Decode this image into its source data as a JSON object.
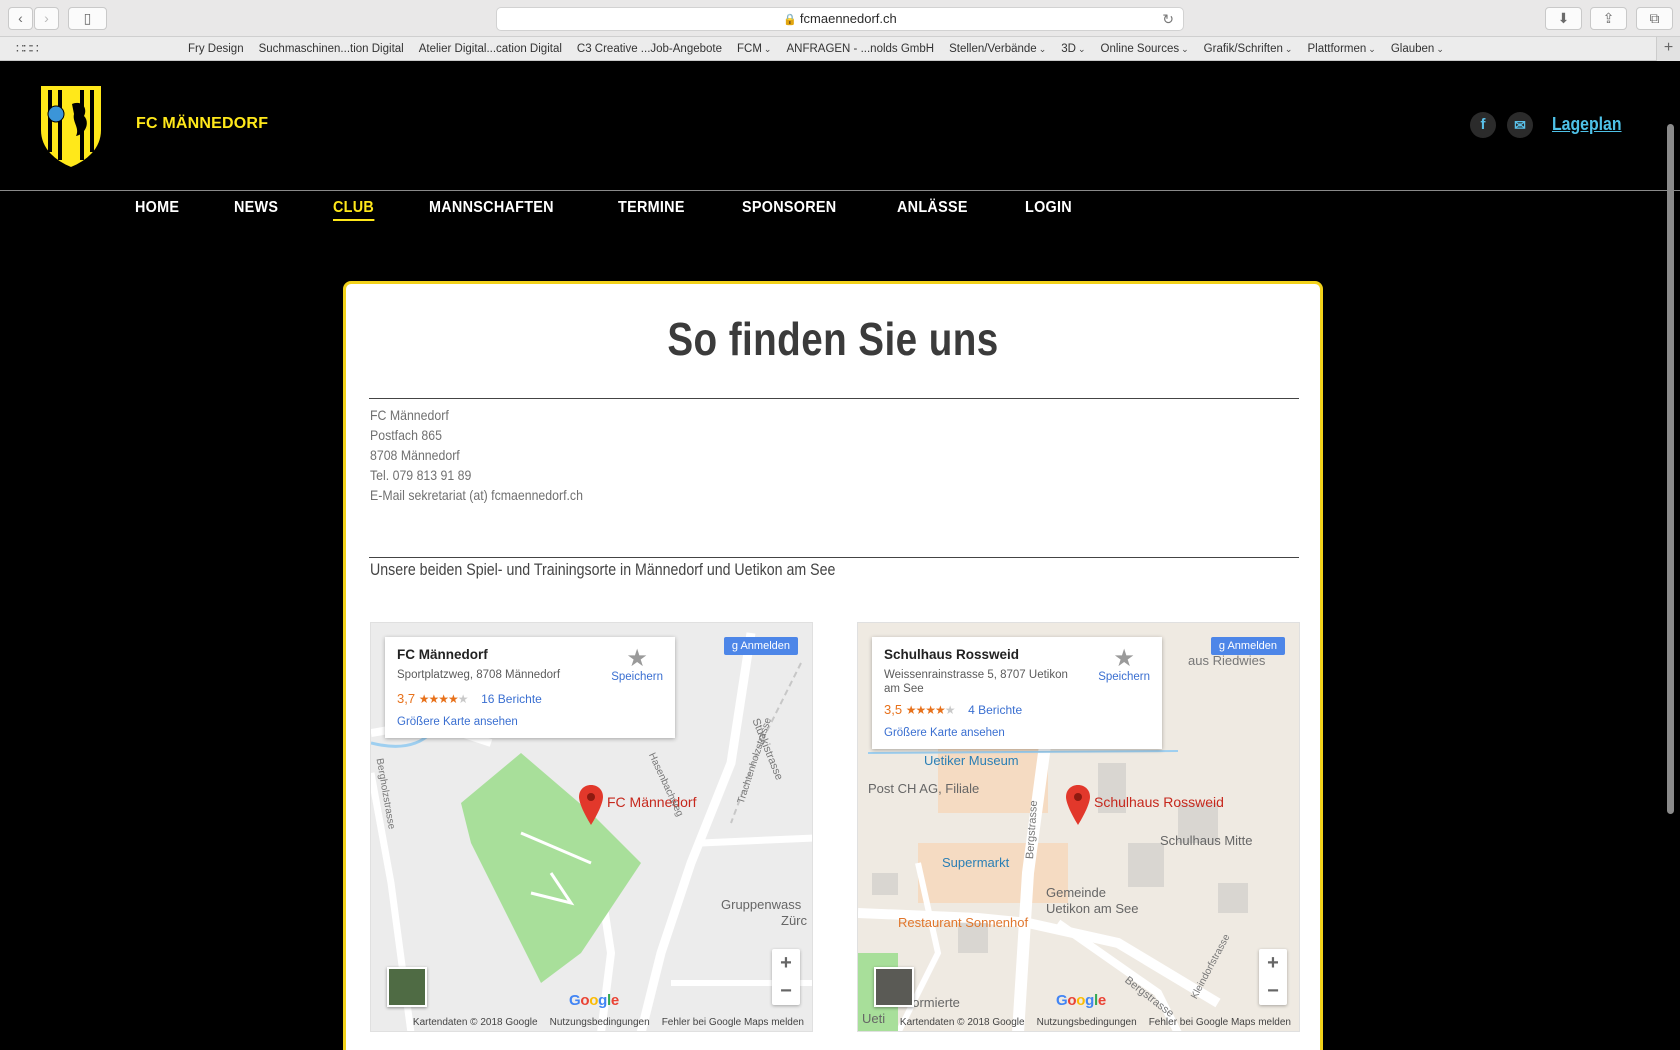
{
  "browser": {
    "url": "fcmaennedorf.ch",
    "bookmarks": [
      {
        "label": "Fry Design",
        "menu": false
      },
      {
        "label": "Suchmaschinen...tion Digital",
        "menu": false
      },
      {
        "label": "Atelier Digital...cation Digital",
        "menu": false
      },
      {
        "label": "C3 Creative ...Job-Angebote",
        "menu": false
      },
      {
        "label": "FCM",
        "menu": true
      },
      {
        "label": "ANFRAGEN - ...nolds GmbH",
        "menu": false
      },
      {
        "label": "Stellen/Verbände",
        "menu": true
      },
      {
        "label": "3D",
        "menu": true
      },
      {
        "label": "Online Sources",
        "menu": true
      },
      {
        "label": "Grafik/Schriften",
        "menu": true
      },
      {
        "label": "Plattformen",
        "menu": true
      },
      {
        "label": "Glauben",
        "menu": true
      }
    ]
  },
  "site": {
    "brand": "FC MÄNNEDORF",
    "logo_text": "FC MÄNNEDORF",
    "lageplan": "Lageplan",
    "nav": [
      {
        "label": "HOME",
        "active": false
      },
      {
        "label": "NEWS",
        "active": false
      },
      {
        "label": "CLUB",
        "active": true
      },
      {
        "label": "MANNSCHAFTEN",
        "active": false
      },
      {
        "label": "TERMINE",
        "active": false
      },
      {
        "label": "SPONSOREN",
        "active": false
      },
      {
        "label": "ANLÄSSE",
        "active": false
      },
      {
        "label": "LOGIN",
        "active": false
      }
    ]
  },
  "content": {
    "heading": "So finden Sie uns",
    "address": [
      "FC Männedorf",
      "Postfach 865",
      "8708 Männedorf",
      "Tel. 079 813 91 89",
      "E-Mail sekretariat (at) fcmaennedorf.ch"
    ],
    "subtitle": "Unsere beiden Spiel- und Trainingsorte in Männedorf und Uetikon am See"
  },
  "maps": [
    {
      "title": "FC Männedorf",
      "address": "Sportplatzweg, 8708 Männedorf",
      "rating": "3,7",
      "stars_full": 3.7,
      "reviews": "16 Berichte",
      "save": "Speichern",
      "larger": "Größere Karte ansehen",
      "signin": "Anmelden",
      "pin_label": "FC Männedorf",
      "labels": [
        "Stuckistrasse",
        "Trachtenholzstrasse",
        "Gruppenwass",
        "Zürc",
        "Bergholzstrasse",
        "Hasenbachweg"
      ],
      "attribution": [
        "Kartendaten © 2018 Google",
        "Nutzungsbedingungen",
        "Fehler bei Google Maps melden"
      ],
      "google": "Google"
    },
    {
      "title": "Schulhaus Rossweid",
      "address": "Weissenrainstrasse 5, 8707 Uetikon am See",
      "rating": "3,5",
      "stars_full": 3.5,
      "reviews": "4 Berichte",
      "save": "Speichern",
      "larger": "Größere Karte ansehen",
      "signin": "Anmelden",
      "pin_label": "Schulhaus Rossweid",
      "labels": [
        "Uetiker Museum",
        "Post CH AG, Filiale",
        "Schulhaus Mitte",
        "Supermarkt",
        "Gemeinde",
        "Uetikon am See",
        "Restaurant Sonnenhof",
        "Bergstrasse",
        "Bergstrasse",
        "aus Riedwies",
        "Kleindorfstrasse",
        "Reformierte",
        "Ueti"
      ],
      "attribution": [
        "Kartendaten © 2018 Google",
        "Nutzungsbedingungen",
        "Fehler bei Google Maps melden"
      ],
      "google": "Google"
    }
  ]
}
